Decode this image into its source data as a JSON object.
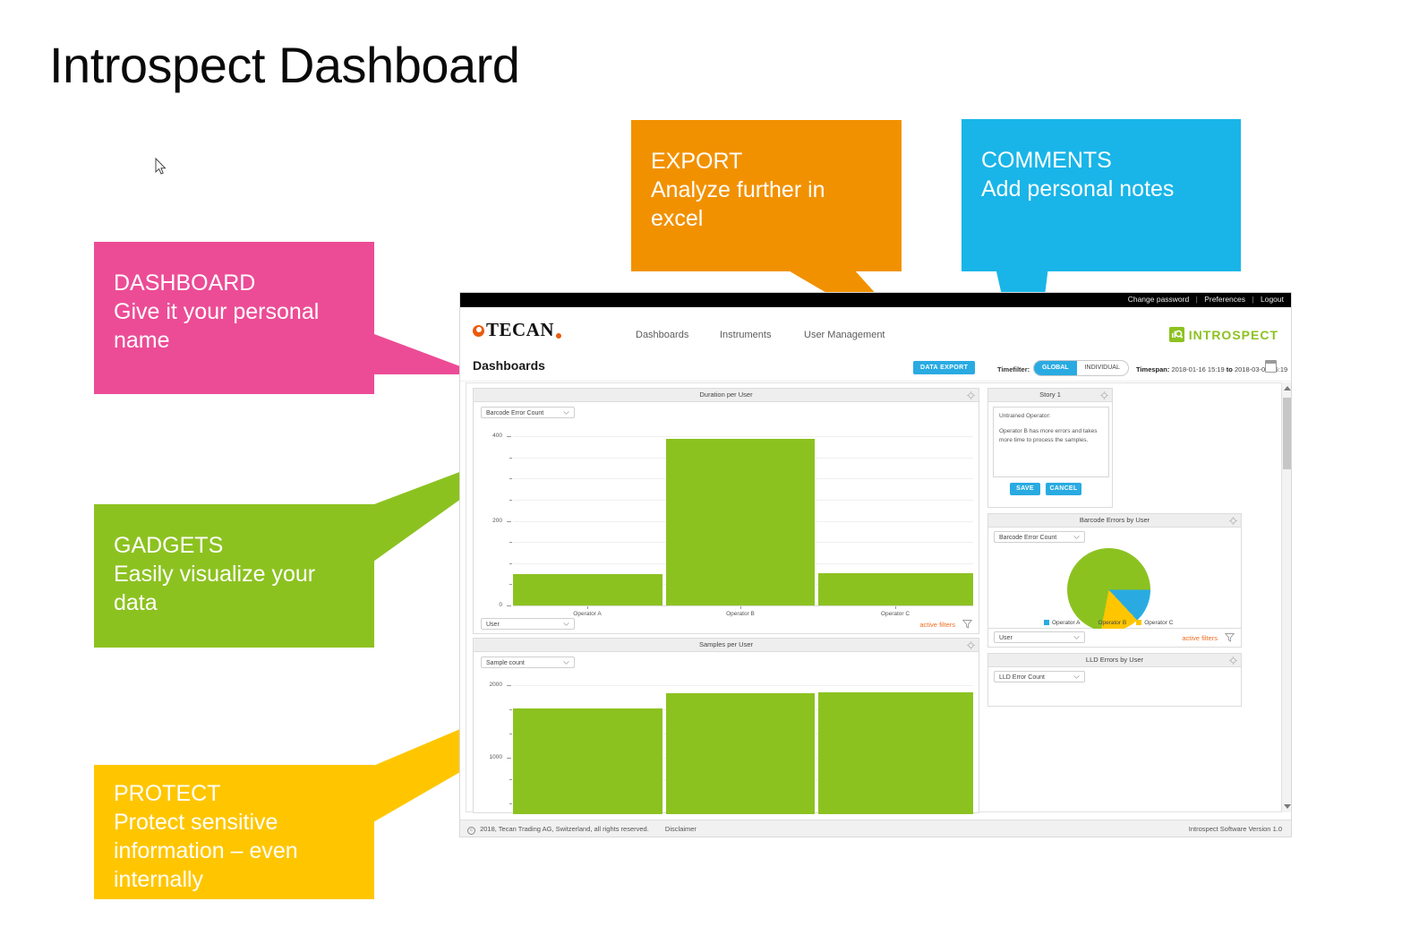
{
  "slide": {
    "title": "Introspect Dashboard"
  },
  "callouts": [
    {
      "id": "dashboard",
      "head": "DASHBOARD",
      "sub": "Give it your personal name",
      "color": "#EC4C96"
    },
    {
      "id": "gadgets",
      "head": "GADGETS",
      "sub": "Easily visualize your data",
      "color": "#8CC220"
    },
    {
      "id": "protect",
      "head": "PROTECT",
      "sub": "Protect sensitive information – even internally",
      "color": "#FFC600"
    },
    {
      "id": "export",
      "head": "EXPORT",
      "sub": "Analyze further in excel",
      "color": "#F29100"
    },
    {
      "id": "comments",
      "head": "COMMENTS",
      "sub": "Add personal notes",
      "color": "#19B5E8"
    }
  ],
  "app": {
    "topbar": {
      "change_password": "Change password",
      "preferences": "Preferences",
      "logout": "Logout",
      "separator": "|"
    },
    "brand": {
      "tecan": "TECAN",
      "introspect": "INTROSPECT"
    },
    "nav": [
      {
        "label": "Dashboards"
      },
      {
        "label": "Instruments"
      },
      {
        "label": "User Management"
      }
    ],
    "subbar": {
      "page_heading": "Dashboards",
      "data_export": "DATA EXPORT",
      "timefilter_label": "Timefilter:",
      "toggle_global": "GLOBAL",
      "toggle_individual": "INDIVIDUAL",
      "timespan_label": "Timespan:",
      "timespan_from": "2018-01-16 15:19",
      "timespan_to_label": "to",
      "timespan_to": "2018-03-01 15:19"
    },
    "footer": {
      "copyright": "2018, Tecan Trading AG, Switzerland, all rights reserved.",
      "disclaimer": "Disclaimer",
      "version": "Introspect Software Version 1.0"
    }
  },
  "gadgets": {
    "duration": {
      "title": "Duration per User",
      "metric_select": "Barcode Error Count",
      "group_select": "User",
      "active_filters": "active filters"
    },
    "samples": {
      "title": "Samples per User",
      "metric_select": "Sample count"
    },
    "story": {
      "title": "Story 1",
      "note_title": "Untrained Operator:",
      "note_body": "Operator B has more errors and takes more time to process the samples.",
      "save": "SAVE",
      "cancel": "CANCEL"
    },
    "barcode_pie": {
      "title": "Barcode Errors by User",
      "metric_select": "Barcode Error Count",
      "group_select": "User",
      "active_filters": "active filters"
    },
    "lld": {
      "title": "LLD Errors by User",
      "metric_select": "LLD Error Count"
    }
  },
  "chart_data": [
    {
      "type": "bar",
      "title": "Duration per User",
      "categories": [
        "Operator A",
        "Operator B",
        "Operator C"
      ],
      "values": [
        75,
        396,
        78
      ],
      "xlabel": "",
      "ylabel": "",
      "ylim": [
        0,
        420
      ],
      "yticks": [
        0,
        200,
        400
      ],
      "ytick_labels": [
        "0",
        "200",
        "400"
      ],
      "grid": true,
      "color": "#8CC220"
    },
    {
      "type": "bar",
      "title": "Samples per User",
      "categories": [
        "Operator A",
        "Operator B",
        "Operator C"
      ],
      "values": [
        1440,
        1870,
        1880
      ],
      "xlabel": "",
      "ylabel": "",
      "ylim": [
        0,
        2100
      ],
      "yticks": [
        1000,
        2000
      ],
      "ytick_labels": [
        "1000",
        "2000"
      ],
      "grid": true,
      "color": "#8CC220"
    },
    {
      "type": "pie",
      "title": "Barcode Errors by User",
      "categories": [
        "Operator A",
        "Operator B",
        "Operator C"
      ],
      "values": [
        13,
        72,
        15
      ],
      "colors": [
        "#29ABE2",
        "#8CC220",
        "#FFC600"
      ],
      "legend": "bottom"
    }
  ]
}
